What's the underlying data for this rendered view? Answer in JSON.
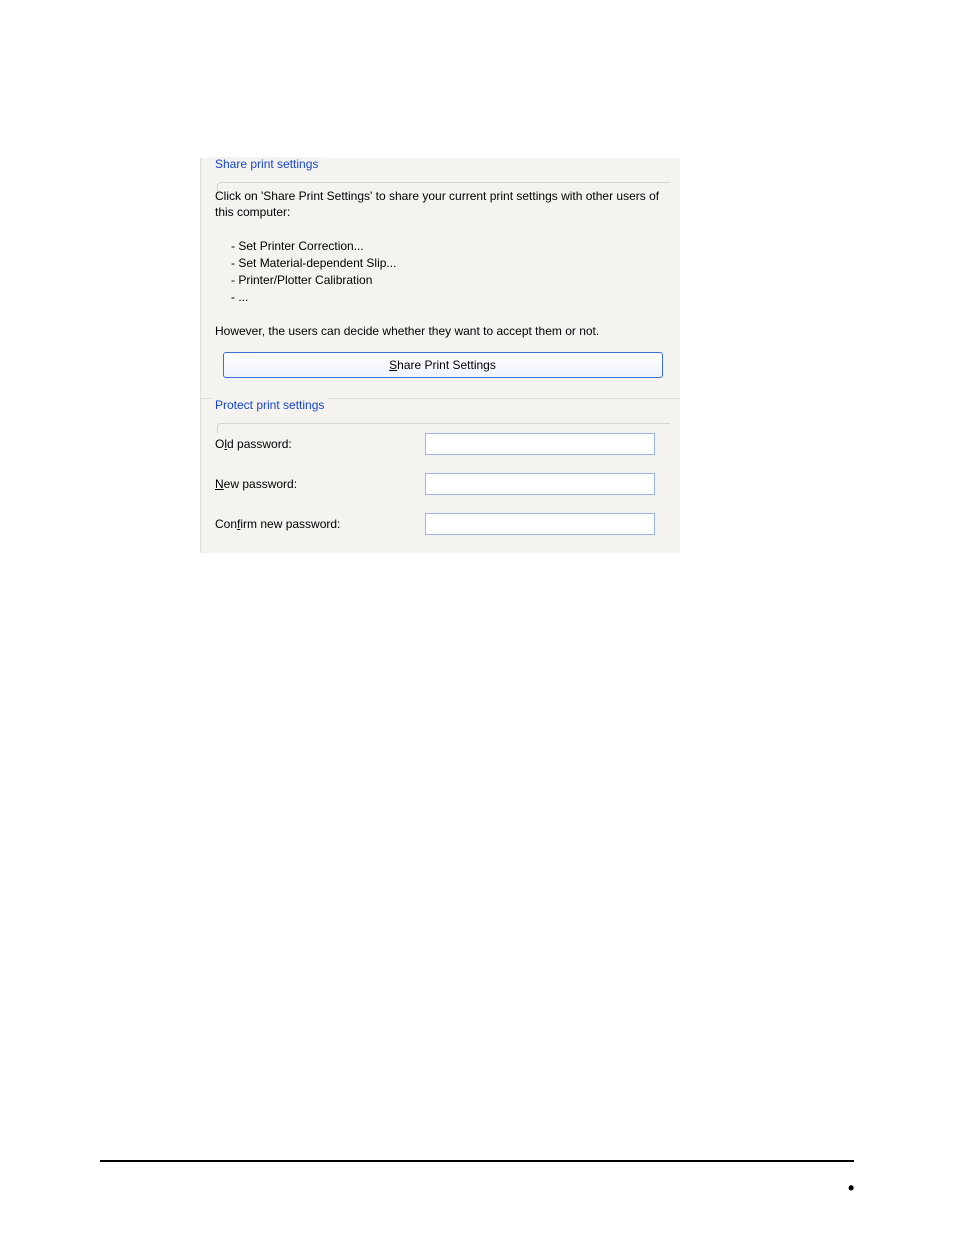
{
  "share_group": {
    "title": "Share print settings",
    "description": "Click on 'Share Print Settings' to share your current print settings with other users of this computer:",
    "bullets": [
      "Set Printer Correction...",
      "Set Material-dependent Slip...",
      "Printer/Plotter Calibration",
      "..."
    ],
    "footer": "However, the users can decide whether they want to accept them or not.",
    "button_prefix": "S",
    "button_rest": "hare Print Settings"
  },
  "protect_group": {
    "title": "Protect print settings",
    "old_pw_prefix": "O",
    "old_pw_u": "l",
    "old_pw_rest": "d password:",
    "new_pw_u": "N",
    "new_pw_rest": "ew password:",
    "confirm_pw_prefix": "Con",
    "confirm_pw_u": "f",
    "confirm_pw_rest": "irm new password:"
  }
}
